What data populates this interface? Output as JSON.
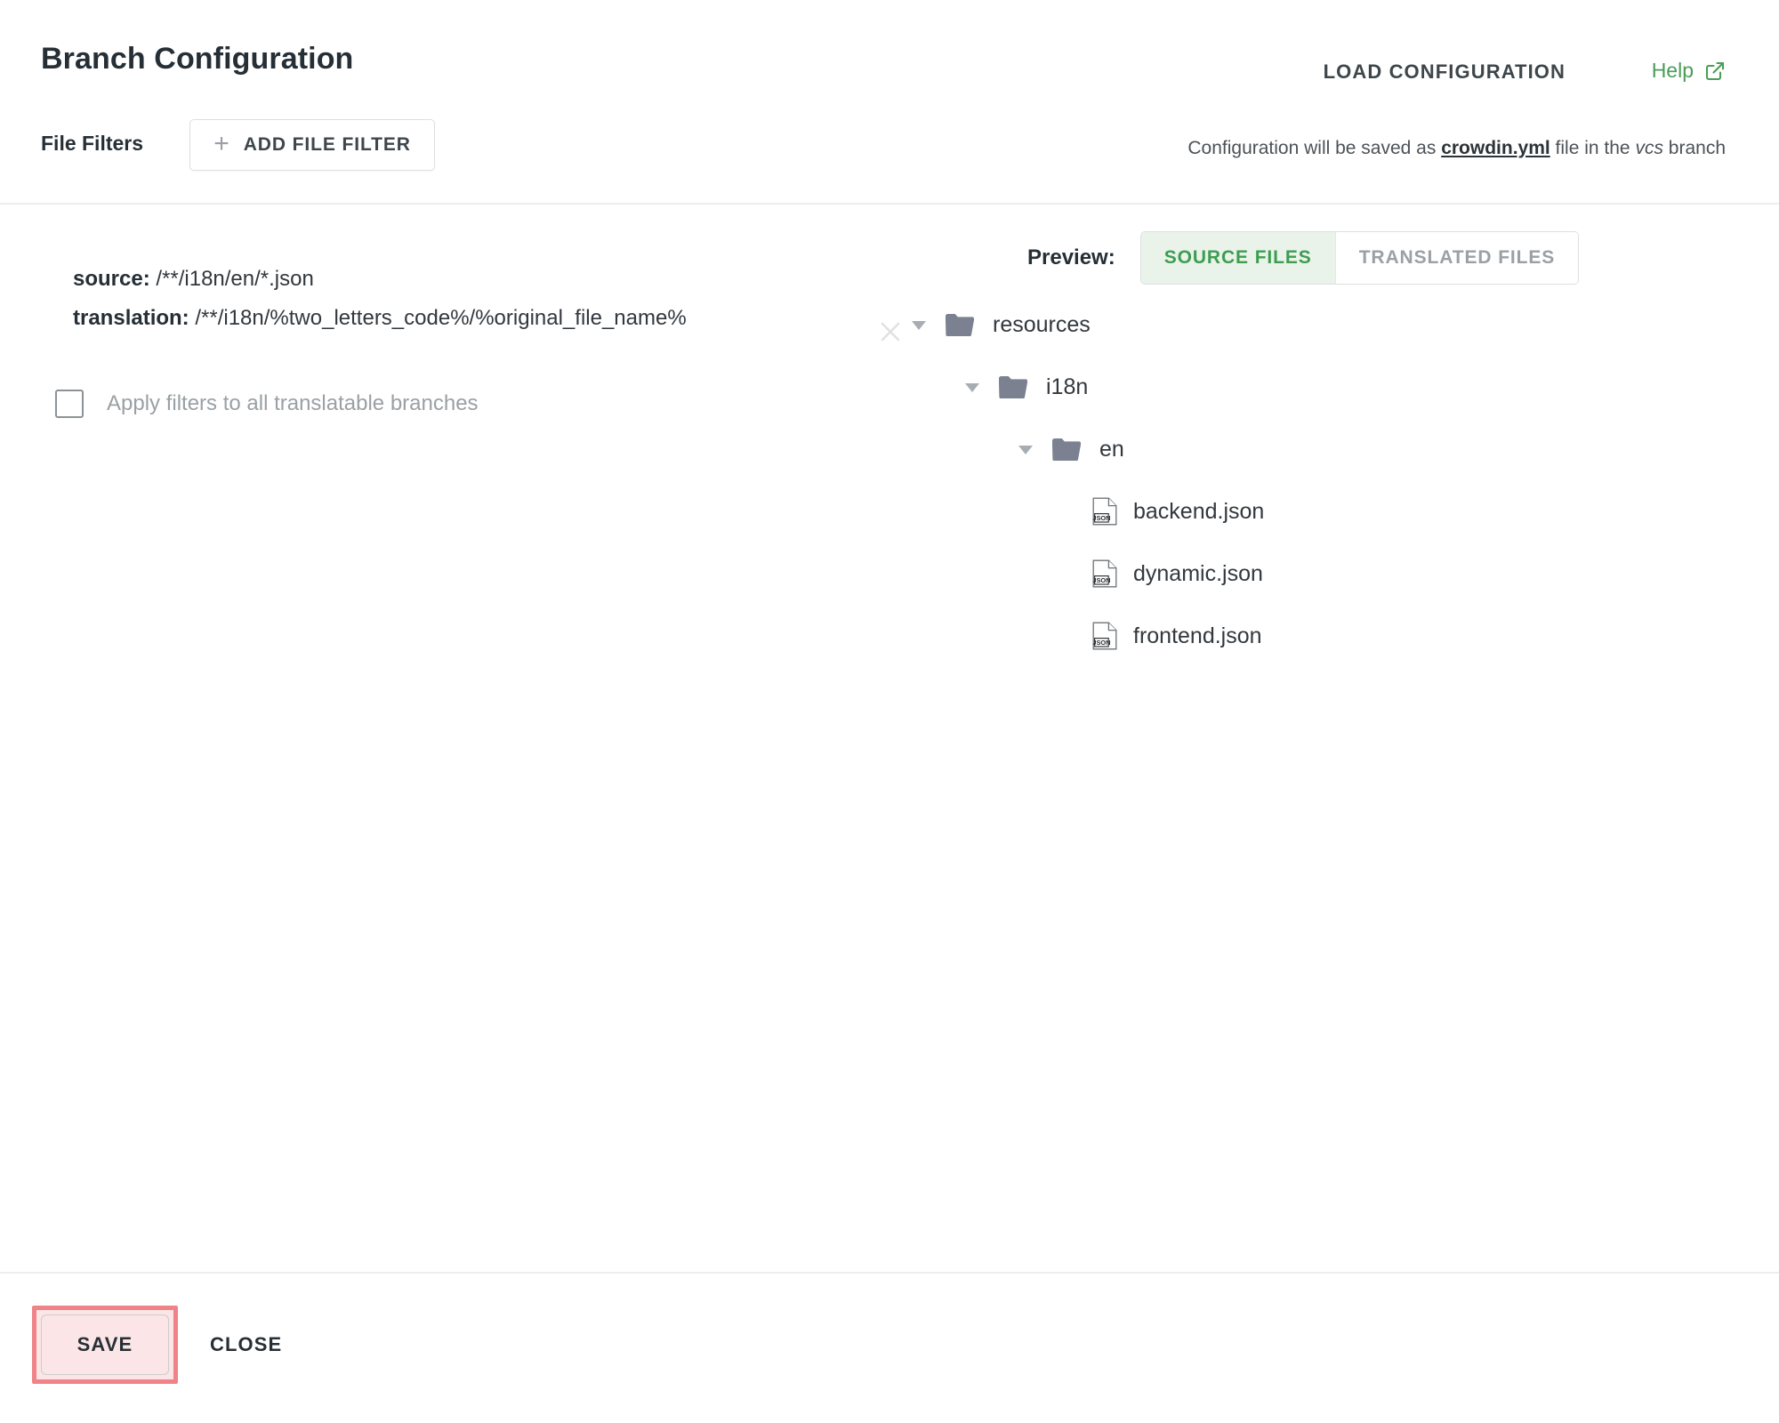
{
  "header": {
    "title": "Branch Configuration",
    "load_configuration_label": "LOAD CONFIGURATION",
    "help_label": "Help",
    "help_icon": "external-link-icon",
    "file_filters_label": "File Filters",
    "add_file_filter_label": "ADD FILE FILTER",
    "add_icon": "plus-icon",
    "config_note": {
      "prefix": "Configuration will be saved as ",
      "file": "crowdin.yml",
      "middle": " file in the ",
      "branch": "vcs",
      "suffix": " branch"
    }
  },
  "filter": {
    "source_label": "source:",
    "source_value": "/**/i18n/en/*.json",
    "translation_label": "translation:",
    "translation_value": "/**/i18n/%two_letters_code%/%original_file_name%",
    "remove_icon": "close-icon",
    "apply_all_label": "Apply filters to all translatable branches",
    "apply_all_checked": false
  },
  "preview": {
    "label": "Preview:",
    "tabs": [
      {
        "label": "SOURCE FILES",
        "active": true
      },
      {
        "label": "TRANSLATED FILES",
        "active": false
      }
    ],
    "tree": [
      {
        "name": "resources",
        "type": "folder",
        "level": 0,
        "expanded": true
      },
      {
        "name": "i18n",
        "type": "folder",
        "level": 1,
        "expanded": true
      },
      {
        "name": "en",
        "type": "folder",
        "level": 2,
        "expanded": true
      },
      {
        "name": "backend.json",
        "type": "file",
        "level": 3,
        "badge": "JSON"
      },
      {
        "name": "dynamic.json",
        "type": "file",
        "level": 3,
        "badge": "JSON"
      },
      {
        "name": "frontend.json",
        "type": "file",
        "level": 3,
        "badge": "JSON"
      }
    ]
  },
  "footer": {
    "save_label": "SAVE",
    "close_label": "CLOSE",
    "save_highlighted": true
  },
  "colors": {
    "accent_green": "#4a9e57",
    "active_tab_bg": "#e9f3ea",
    "active_tab_text": "#3e9d51",
    "text_primary": "#262f36",
    "text_muted": "#9aa0a4",
    "highlight_border": "#ef8388",
    "highlight_fill": "#fbe5e6",
    "divider": "#eceded",
    "folder_icon": "#7b8190"
  }
}
